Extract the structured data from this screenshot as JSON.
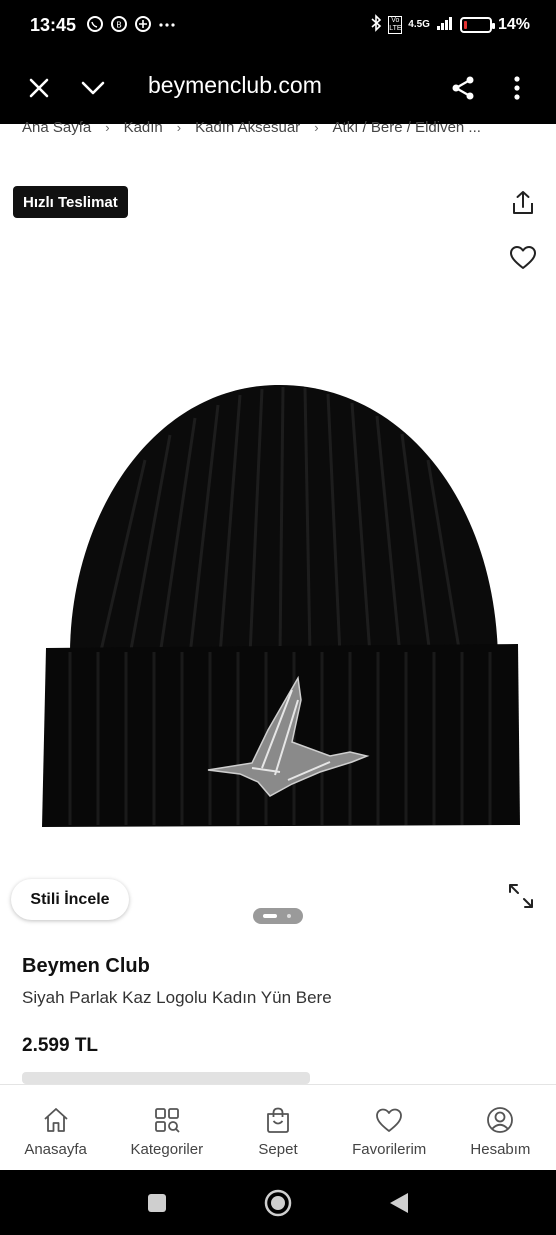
{
  "status_bar": {
    "time": "13:45",
    "left_icons": [
      "whatsapp-icon",
      "whatsapp-business-icon",
      "message-plus-icon",
      "more-dots-icon"
    ],
    "network": "4.5G",
    "volte": "Vo LTE",
    "battery_percent": 14,
    "battery_text": "14%"
  },
  "browser": {
    "url": "beymenclub.com",
    "close_icon": "close-icon",
    "collapse_icon": "chevron-down-icon",
    "share_icon": "share-icon",
    "menu_icon": "kebab-menu-icon"
  },
  "breadcrumb": {
    "items": [
      "Ana Sayfa",
      "Kadın",
      "Kadın Aksesuar",
      "Atkı / Bere / Eldiven ..."
    ]
  },
  "media": {
    "badge": "Hızlı Teslimat",
    "stil_button": "Stili İncele",
    "image_alt": "Siyah örgü bere, kaz logolu",
    "carousel_pages": 2,
    "carousel_active": 1
  },
  "product": {
    "brand": "Beymen Club",
    "name": "Siyah Parlak Kaz Logolu Kadın Yün Bere",
    "price": "2.599 TL"
  },
  "bottom_nav": {
    "items": [
      {
        "label": "Anasayfa",
        "icon": "home-icon"
      },
      {
        "label": "Kategoriler",
        "icon": "categories-icon"
      },
      {
        "label": "Sepet",
        "icon": "bag-icon"
      },
      {
        "label": "Favorilerim",
        "icon": "heart-icon"
      },
      {
        "label": "Hesabım",
        "icon": "account-icon"
      }
    ]
  },
  "colors": {
    "header_bg": "#000000",
    "badge_bg": "#111111",
    "battery_low": "#e33333"
  }
}
